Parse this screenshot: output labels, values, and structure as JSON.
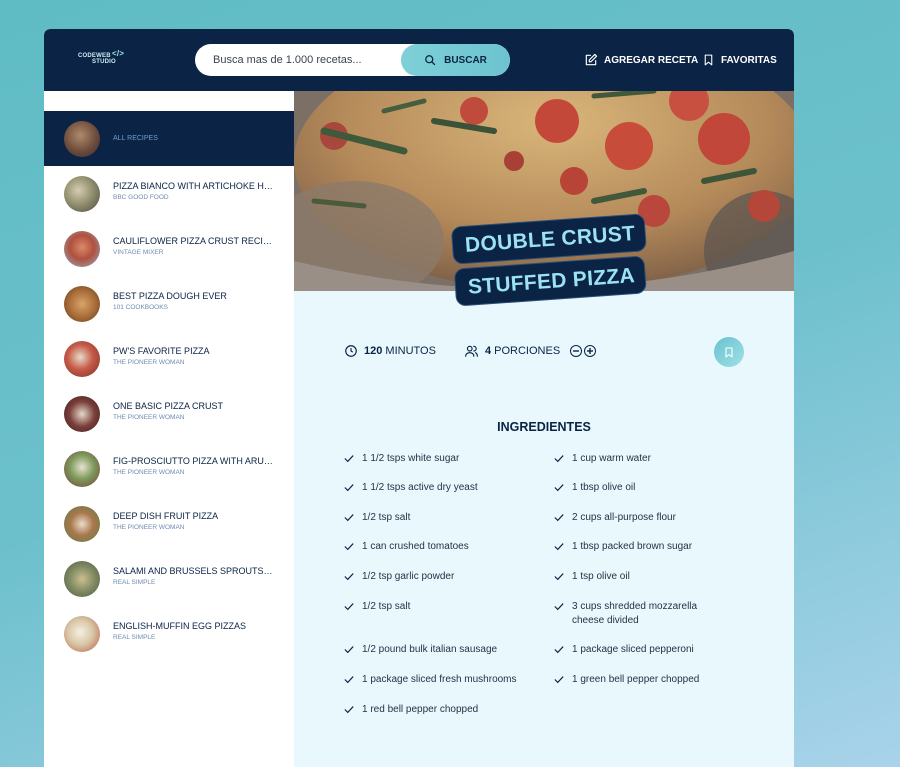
{
  "header": {
    "logo_line1": "CODEWEB",
    "logo_line2": "STUDIO",
    "logo_mark": "</>",
    "search_placeholder": "Busca mas de 1.000 recetas...",
    "search_button": "BUSCAR",
    "add_recipe": "AGREGAR RECETA",
    "favorites": "FAVORITAS"
  },
  "sidebar": {
    "items": [
      {
        "title": "",
        "publisher": "ALL RECIPES",
        "active": true,
        "thumb_color": "#8a6a55"
      },
      {
        "title": "PIZZA BIANCO WITH ARTICHOKE HEARTS",
        "publisher": "BBC GOOD FOOD",
        "thumb_color": "#9a8c72"
      },
      {
        "title": "CAULIFLOWER PIZZA CRUST RECIPE",
        "publisher": "VINTAGE MIXER",
        "thumb_color": "#b3634c"
      },
      {
        "title": "BEST PIZZA DOUGH EVER",
        "publisher": "101 COOKBOOKS",
        "thumb_color": "#a46b3a"
      },
      {
        "title": "PW'S FAVORITE PIZZA",
        "publisher": "THE PIONEER WOMAN",
        "thumb_color": "#b54a3c"
      },
      {
        "title": "ONE BASIC PIZZA CRUST",
        "publisher": "THE PIONEER WOMAN",
        "thumb_color": "#6e3b34"
      },
      {
        "title": "FIG-PROSCIUTTO PIZZA WITH ARUGULA",
        "publisher": "THE PIONEER WOMAN",
        "thumb_color": "#6f8a55"
      },
      {
        "title": "DEEP DISH FRUIT PIZZA",
        "publisher": "THE PIONEER WOMAN",
        "thumb_color": "#9a7450"
      },
      {
        "title": "SALAMI AND BRUSSELS SPROUTS PIZZA",
        "publisher": "REAL SIMPLE",
        "thumb_color": "#7f8a64"
      },
      {
        "title": "ENGLISH-MUFFIN EGG PIZZAS",
        "publisher": "REAL SIMPLE",
        "thumb_color": "#c9b79c"
      }
    ]
  },
  "recipe": {
    "title_line1": "DOUBLE CRUST",
    "title_line2": "STUFFED PIZZA",
    "cook_time": "120",
    "cook_time_unit": "MINUTOS",
    "servings": "4",
    "servings_unit": "PORCIONES",
    "ingredients_heading": "INGREDIENTES",
    "ingredients_left": [
      "1 1/2 tsps white sugar",
      "1 1/2 tsps active dry yeast",
      "1/2 tsp salt",
      "1 can crushed tomatoes",
      "1/2 tsp garlic powder",
      "1/2 tsp salt",
      "1/2 pound bulk italian sausage",
      "1 package sliced fresh mushrooms",
      "1 red bell pepper chopped"
    ],
    "ingredients_right": [
      "1 cup warm water",
      "1 tbsp olive oil",
      "2 cups all-purpose flour",
      "1 tbsp packed brown sugar",
      "1 tsp olive oil",
      "3 cups shredded mozzarella cheese divided",
      "1 package sliced pepperoni",
      "1 green bell pepper chopped"
    ]
  },
  "colors": {
    "navy": "#0b2344",
    "accent": "#6cc3cf",
    "panel": "#e8f8fd"
  }
}
